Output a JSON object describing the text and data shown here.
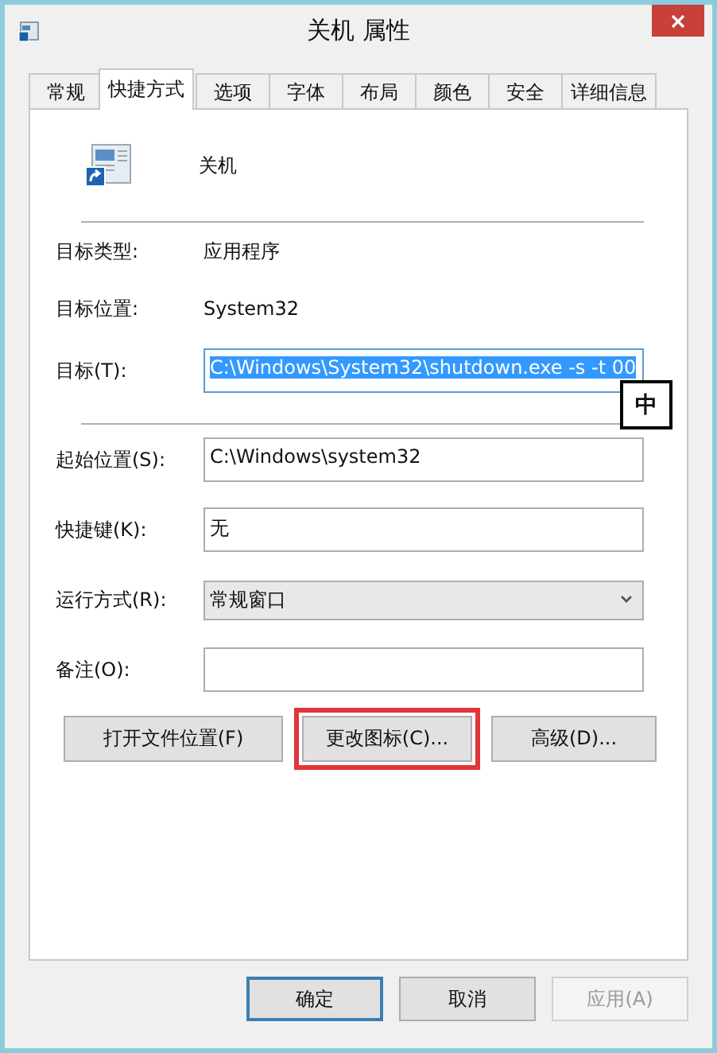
{
  "window": {
    "title": "关机 属性"
  },
  "tabs": [
    {
      "label": "常规",
      "selected": false
    },
    {
      "label": "快捷方式",
      "selected": true
    },
    {
      "label": "选项",
      "selected": false
    },
    {
      "label": "字体",
      "selected": false
    },
    {
      "label": "布局",
      "selected": false
    },
    {
      "label": "颜色",
      "selected": false
    },
    {
      "label": "安全",
      "selected": false
    },
    {
      "label": "详细信息",
      "selected": false
    }
  ],
  "shortcut_name": "关机",
  "info": [
    {
      "label": "目标类型:",
      "value": "应用程序"
    },
    {
      "label": "目标位置:",
      "value": "System32"
    }
  ],
  "target": {
    "label": "目标(T):",
    "value": "C:\\Windows\\System32\\shutdown.exe -s -t 00",
    "text_selected": true
  },
  "ime_indicator": "中",
  "fields": [
    {
      "kind": "text",
      "label": "起始位置(S):",
      "value": "C:\\Windows\\system32"
    },
    {
      "kind": "text",
      "label": "快捷键(K):",
      "value": "无"
    },
    {
      "kind": "dropdown",
      "label": "运行方式(R):",
      "value": "常规窗口"
    },
    {
      "kind": "text",
      "label": "备注(O):"
    }
  ],
  "actions": [
    {
      "label": "打开文件位置(F)",
      "highlighted": false
    },
    {
      "label": "更改图标(C)...",
      "highlighted": true
    },
    {
      "label": "高级(D)...",
      "highlighted": false
    }
  ],
  "footer": [
    {
      "label": "确定",
      "default": true,
      "disabled": false
    },
    {
      "label": "取消",
      "default": false,
      "disabled": false
    },
    {
      "label": "应用(A)",
      "default": false,
      "disabled": true
    }
  ]
}
